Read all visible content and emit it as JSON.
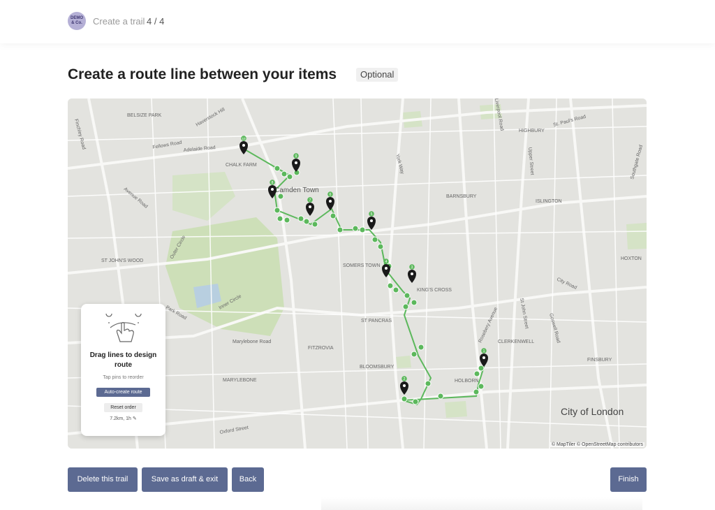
{
  "header": {
    "logo_line1": "DEMO",
    "logo_line2": "& Co.",
    "crumb": "Create a trail",
    "step": "4 / 4"
  },
  "page": {
    "title": "Create a route line between your items",
    "optional_badge": "Optional"
  },
  "map": {
    "attribution": "© MapTiler © OpenStreetMap contributors",
    "big_label": "City of London",
    "labels": [
      "BELSIZE PARK",
      "Haverstock Hill",
      "Fellows Road",
      "Adelaide Road",
      "CHALK FARM",
      "Camden Town",
      "Finchley Road",
      "Avenue Road",
      "ST JOHN'S WOOD",
      "Outer Circle",
      "Park Road",
      "Inner Circle",
      "Marylebone Road",
      "MARYLEBONE",
      "Oxford Street",
      "FITZROVIA",
      "BLOOMSBURY",
      "ST PANCRAS",
      "SOMERS TOWN",
      "KING'S CROSS",
      "York Way",
      "BARNSBURY",
      "Liverpool Road",
      "HIGHBURY",
      "St. Paul's Road",
      "Upper Street",
      "ISLINGTON",
      "Southgate Road",
      "HOXTON",
      "City Road",
      "Rosebery Avenue",
      "St John Street",
      "Goswell Road",
      "CLERKENWELL",
      "FINSBURY",
      "HOLBORN"
    ],
    "pins": [
      "1",
      "2",
      "3",
      "4",
      "5",
      "6",
      "7",
      "8",
      "9",
      "10"
    ],
    "route_color": "#5cb85c",
    "pin_color": "#1a1a1a"
  },
  "card": {
    "title": "Drag lines to design route",
    "subtitle": "Tap pins to reorder",
    "auto_button": "Auto-create route",
    "reset_button": "Reset order",
    "distance": "7.2km, 1h"
  },
  "footer": {
    "delete_label": "Delete this trail",
    "draft_label": "Save as draft & exit",
    "back_label": "Back",
    "finish_label": "Finish"
  }
}
